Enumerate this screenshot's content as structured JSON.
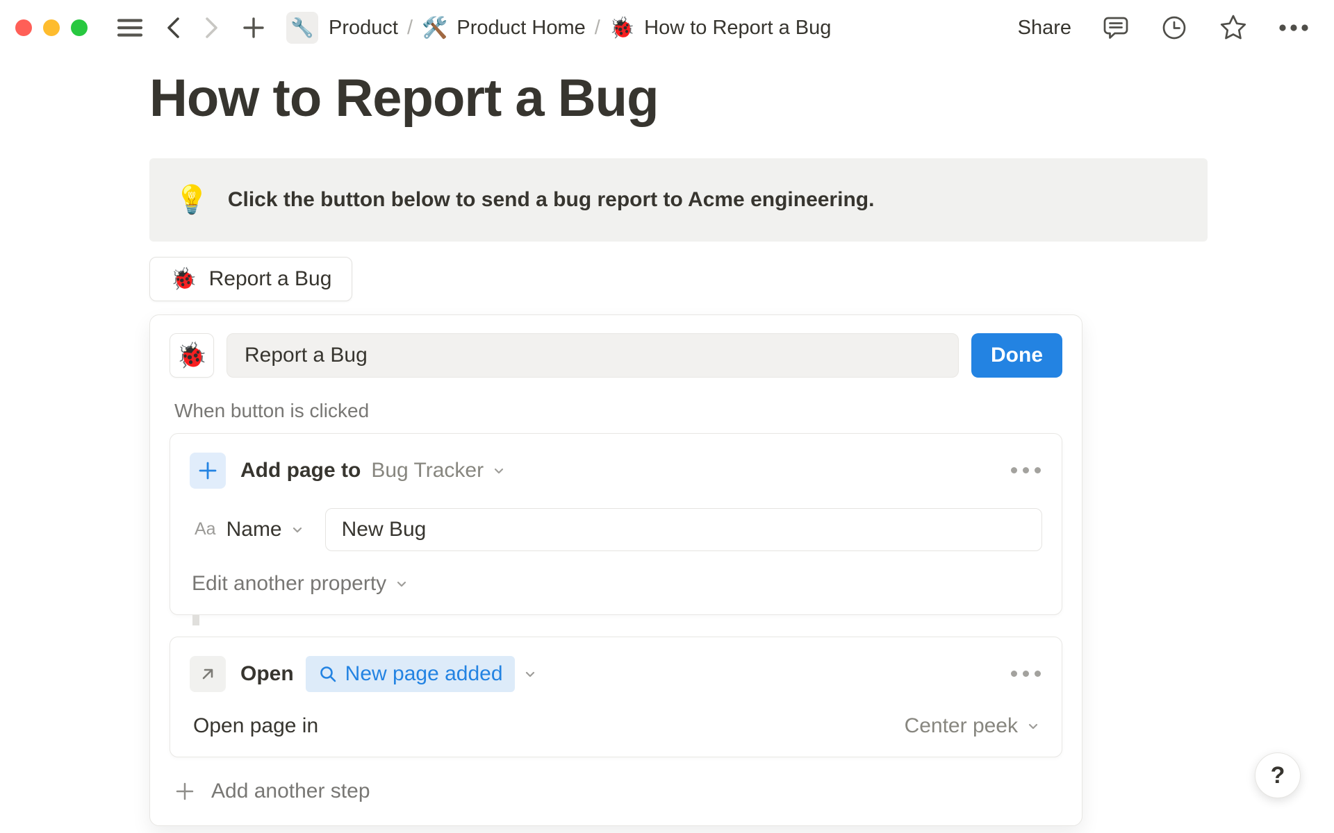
{
  "colors": {
    "accent_blue": "#2383e2",
    "text_dark": "#37352f",
    "text_gray": "#787774",
    "callout_bg": "#f1f1ef",
    "chip_bg": "#ddebf9",
    "traffic_red": "#ff5f57",
    "traffic_yellow": "#febc2e",
    "traffic_green": "#28c840"
  },
  "topbar": {
    "breadcrumb": {
      "items": [
        {
          "icon": "🔧",
          "label": "Product"
        },
        {
          "icon": "🛠️",
          "label": "Product Home"
        },
        {
          "icon": "🐞",
          "label": "How to Report a Bug"
        }
      ],
      "separator": "/"
    },
    "share_label": "Share"
  },
  "page": {
    "title": "How to Report a Bug",
    "callout": {
      "icon": "💡",
      "text": "Click the button below to send a bug report to Acme engineering."
    },
    "bug_button": {
      "icon": "🐞",
      "label": "Report a Bug"
    }
  },
  "panel": {
    "button_icon": "🐞",
    "button_name_value": "Report a Bug",
    "done_label": "Done",
    "trigger_label": "When button is clicked",
    "step_add_page": {
      "action_label": "Add page to",
      "target_value": "Bug Tracker",
      "property_type": "Aa",
      "property_name": "Name",
      "property_value": "New Bug",
      "edit_another_label": "Edit another property"
    },
    "step_open": {
      "action_label": "Open",
      "target_chip_label": "New page added",
      "open_in_label": "Open page in",
      "open_in_value": "Center peek"
    },
    "add_step_label": "Add another step"
  },
  "help_label": "?"
}
